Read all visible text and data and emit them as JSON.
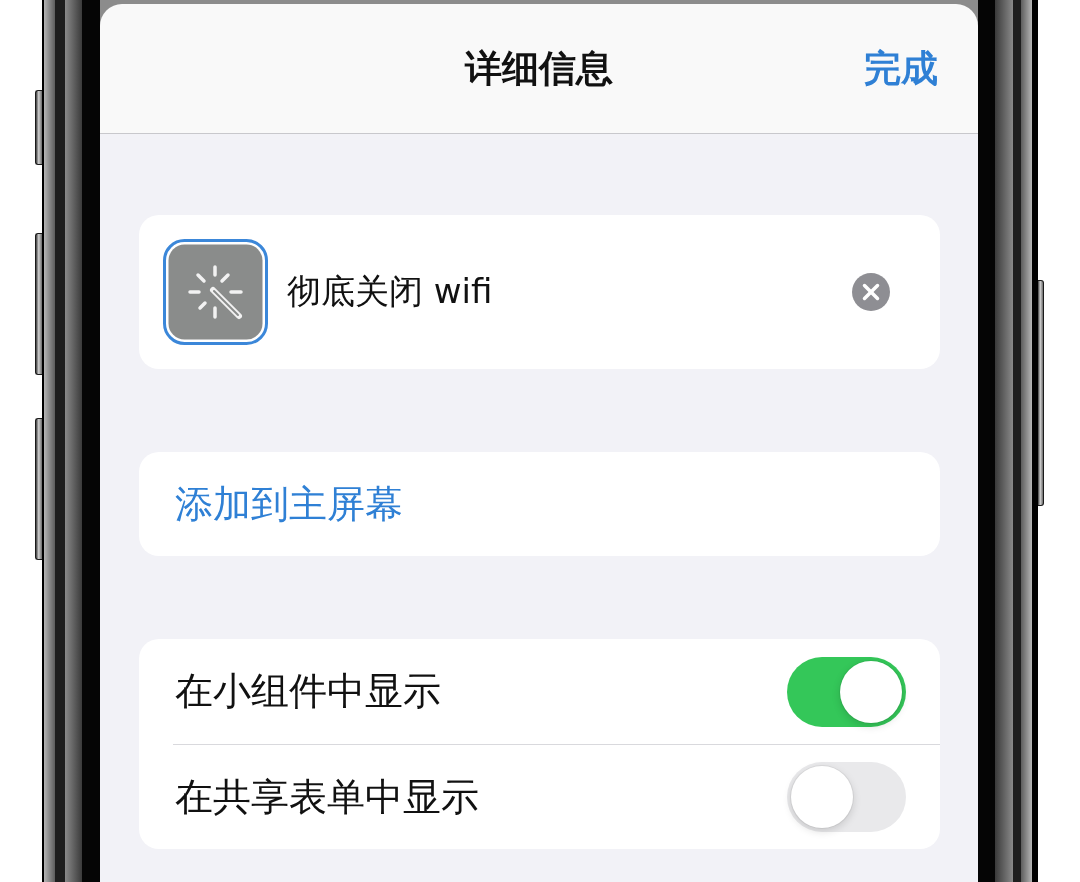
{
  "header": {
    "title": "详细信息",
    "done_button": "完成"
  },
  "shortcut": {
    "icon": {
      "selected": true
    },
    "name": "彻底关闭 wifi"
  },
  "home_screen_button": {
    "label": "添加到主屏幕"
  },
  "settings": [
    {
      "label": "在小组件中显示",
      "on": true
    },
    {
      "label": "在共享表单中显示",
      "on": false
    }
  ]
}
